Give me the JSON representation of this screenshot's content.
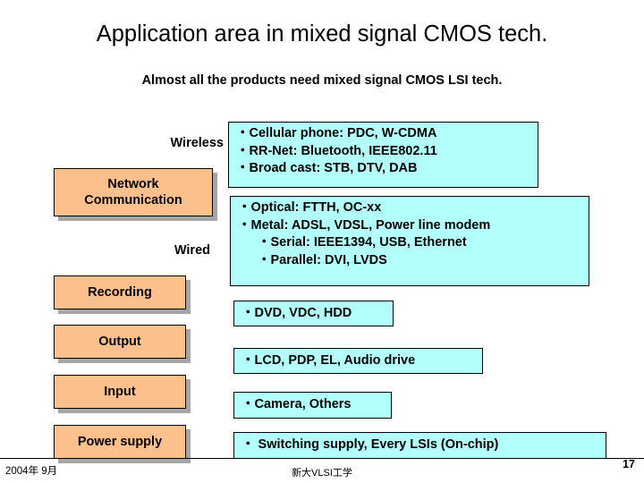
{
  "slide": {
    "title": "Application area in mixed signal CMOS tech.",
    "subtitle": "Almost all the products need mixed signal CMOS LSI tech.",
    "categories": [
      {
        "label": "Wireless",
        "boxed": false
      },
      {
        "label": "Network",
        "label2": "Communication",
        "boxed": true
      },
      {
        "label": "Wired",
        "boxed": false
      },
      {
        "label": "Recording",
        "boxed": true
      },
      {
        "label": "Output",
        "boxed": true
      },
      {
        "label": "Input",
        "boxed": true
      },
      {
        "label": "Power supply",
        "boxed": true
      }
    ],
    "content": [
      {
        "lines": [
          "・Cellular phone: PDC, W-CDMA",
          "・RR-Net: Bluetooth, IEEE802.11",
          "・Broad cast: STB, DTV, DAB"
        ]
      },
      {
        "lines": [
          "・Optical: FTTH, OC-xx",
          "・Metal: ADSL, VDSL, Power line modem",
          "・Serial: IEEE1394, USB, Ethernet",
          "・Parallel: DVI, LVDS"
        ]
      },
      {
        "lines": [
          "・DVD, VDC, HDD"
        ]
      },
      {
        "lines": [
          "・LCD, PDP, EL, Audio drive"
        ]
      },
      {
        "lines": [
          "・Camera, Others"
        ]
      },
      {
        "lines": [
          "・ Switching supply, Every LSIs (On-chip)"
        ]
      }
    ],
    "footer": {
      "left": "2004年  9月",
      "center": "新大VLSI工学",
      "page": "17"
    },
    "colors": {
      "category_box": "#fbc08c",
      "content_box": "#b2fffb",
      "text": "#000000"
    }
  }
}
